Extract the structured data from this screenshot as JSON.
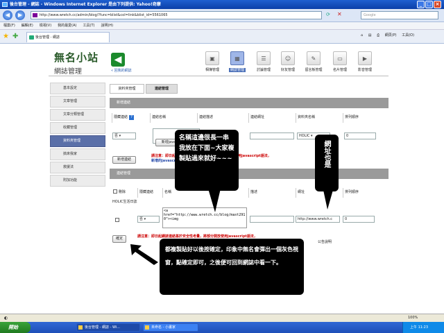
{
  "browser": {
    "title": "後台管理 - 網誌 - Windows Internet Explorer 是由下列提供: Yahoo!奇摩",
    "url": "http://www.wretch.cc/admin/blog/?func=blist&col=link&blist_id=5561065",
    "search_placeholder": "Google",
    "menu": [
      "檔案(F)",
      "編輯(E)",
      "檢視(V)",
      "我的最愛(A)",
      "工具(T)",
      "說明(H)"
    ],
    "tab_label": "後台管理 - 網誌",
    "tools": [
      "網頁(P)",
      "工具(O)"
    ],
    "status_zoom": "100%"
  },
  "site": {
    "logo": "無名小站",
    "subtitle": "網誌管理",
    "back_label": "« 回我的網誌",
    "top_icons": [
      {
        "label": "相簿管理",
        "icon": "photo-album-icon"
      },
      {
        "label": "網誌管理",
        "icon": "blog-icon"
      },
      {
        "label": "討論管理",
        "icon": "chat-icon"
      },
      {
        "label": "好友管理",
        "icon": "friends-icon"
      },
      {
        "label": "留言板管理",
        "icon": "guestbook-icon"
      },
      {
        "label": "名片管理",
        "icon": "namecard-icon"
      },
      {
        "label": "影音管理",
        "icon": "video-icon"
      }
    ],
    "active_top_icon": "網誌管理"
  },
  "sidebar": {
    "items": [
      "基本設定",
      "文章管理",
      "文章分類管理",
      "收藏管理",
      "資料夾管理",
      "搞來我家",
      "救援法",
      "附加功能"
    ],
    "active": "資料夾管理"
  },
  "main": {
    "tabs": [
      "資料夾管理",
      "連結管理"
    ],
    "new_section": "新增連結",
    "new_headers": [
      "隱藏連結",
      "連結名稱",
      "連結描述",
      "連結網址",
      "資料夾名稱",
      "排列順序"
    ],
    "hide_value": "否",
    "folder_value": "HOLIC",
    "order_value": "0",
    "new_button": "新增連結",
    "name_btn": "新增java",
    "warning1_red": "請注意：即日起網誌連結基於安全性考量，將部分開放使用javascript語法，",
    "warning1_blue": "新增的javascript將無法新增成功，詳見公告說明",
    "manage_section": "連結管理",
    "manage_headers": [
      "刪除",
      "隱藏連結",
      "名稱",
      "描述",
      "網址",
      "排列順序"
    ],
    "group_label": "HOLIC生活日誌",
    "row_hide": "否",
    "row_code": "<a href=\"http://www.wretch.cc/blog/maxt2910\"><img",
    "row_url": "http://www.wretch.c",
    "row_order": "0",
    "confirm_button": "確定",
    "warning2": "請注意：即日起網誌連結基於安全性考量，將部分開放使用javascript語法，",
    "warning2_tail": "公告說明"
  },
  "callouts": {
    "top": "名稱這邊很長一串我放在下面~大家複製貼過來就好~~~",
    "right": "網址也是",
    "bottom": "都複製貼好以後按確定，印象中無名會彈出一個灰色視窗，點確定即可，之後便可回到網誌中看一下。"
  },
  "taskbar": {
    "start": "開始",
    "items": [
      "後台管理 - 網誌 - Wi...",
      "未命名 - 小畫家"
    ],
    "clock": "上午 11:23"
  }
}
